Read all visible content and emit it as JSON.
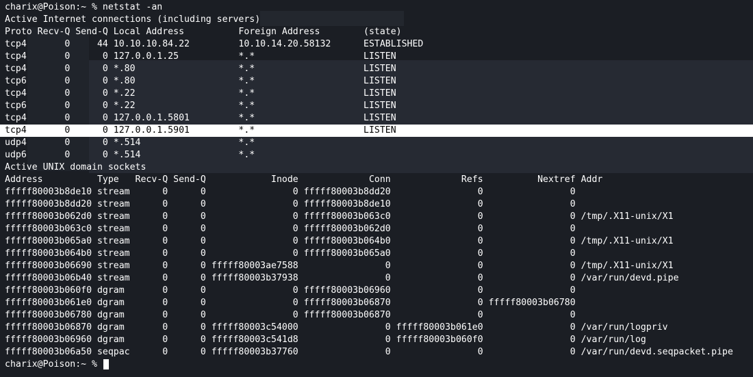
{
  "colors": {
    "background": "#1b1e24",
    "foreground": "#ffffff",
    "highlight_bg": "#ffffff",
    "highlight_fg": "#000000"
  },
  "terminal": {
    "prompt": "charix@Poison:~ % ",
    "command": "netstat -an",
    "highlighted_line_index": 10,
    "lines": [
      "charix@Poison:~ % netstat -an",
      "Active Internet connections (including servers)",
      "Proto Recv-Q Send-Q Local Address          Foreign Address        (state)",
      "tcp4       0     44 10.10.10.84.22         10.10.14.20.58132      ESTABLISHED",
      "tcp4       0      0 127.0.0.1.25           *.*                    LISTEN",
      "tcp4       0      0 *.80                   *.*                    LISTEN",
      "tcp6       0      0 *.80                   *.*                    LISTEN",
      "tcp4       0      0 *.22                   *.*                    LISTEN",
      "tcp6       0      0 *.22                   *.*                    LISTEN",
      "tcp4       0      0 127.0.0.1.5801         *.*                    LISTEN",
      "tcp4       0      0 127.0.0.1.5901         *.*                    LISTEN",
      "udp4       0      0 *.514                  *.*",
      "udp6       0      0 *.514                  *.*",
      "Active UNIX domain sockets",
      "Address          Type   Recv-Q Send-Q            Inode             Conn             Refs          Nextref Addr",
      "fffff80003b8de10 stream      0      0                0 fffff80003b8dd20                0                0",
      "fffff80003b8dd20 stream      0      0                0 fffff80003b8de10                0                0",
      "fffff80003b062d0 stream      0      0                0 fffff80003b063c0                0                0 /tmp/.X11-unix/X1",
      "fffff80003b063c0 stream      0      0                0 fffff80003b062d0                0                0",
      "fffff80003b065a0 stream      0      0                0 fffff80003b064b0                0                0 /tmp/.X11-unix/X1",
      "fffff80003b064b0 stream      0      0                0 fffff80003b065a0                0                0",
      "fffff80003b06690 stream      0      0 fffff80003ae7588                0                0                0 /tmp/.X11-unix/X1",
      "fffff80003b06b40 stream      0      0 fffff80003b37938                0                0                0 /var/run/devd.pipe",
      "fffff80003b060f0 dgram       0      0                0 fffff80003b06960                0                0",
      "fffff80003b061e0 dgram       0      0                0 fffff80003b06870                0 fffff80003b06780",
      "fffff80003b06780 dgram       0      0                0 fffff80003b06870                0                0",
      "fffff80003b06870 dgram       0      0 fffff80003c54000                0 fffff80003b061e0                0 /var/run/logpriv",
      "fffff80003b06960 dgram       0      0 fffff80003c541d8                0 fffff80003b060f0                0 /var/run/log",
      "fffff80003b06a50 seqpac      0      0 fffff80003b37760                0                0                0 /var/run/devd.seqpacket.pipe"
    ],
    "last_prompt": "charix@Poison:~ % "
  }
}
